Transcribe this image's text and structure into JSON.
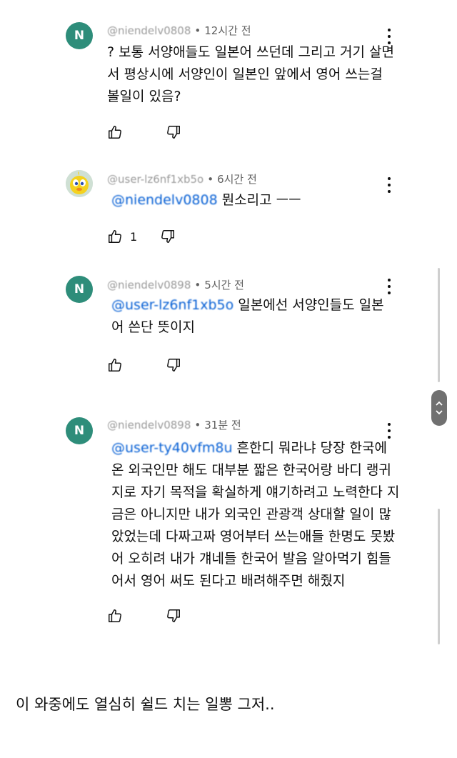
{
  "comments": [
    {
      "avatar_letter": "N",
      "handle": "@niendelv0808",
      "time": "12시간 전",
      "mention": "",
      "text": "? 보통 서양애들도 일본어 쓰던데 그리고 거기 살면\n서 평상시에 서양인이 일본인 앞에서 영어 쓰는걸\n볼일이 있음?",
      "likes": ""
    },
    {
      "avatar_letter": "",
      "handle": "@user-lz6nf1xb5o",
      "time": "6시간 전",
      "mention": "@niendelv0808",
      "text": "뭔소리고 ㅡㅡ",
      "likes": "1"
    },
    {
      "avatar_letter": "N",
      "handle": "@niendelv0898",
      "time": "5시간 전",
      "mention": "@user-lz6nf1xb5o",
      "text": "일본에선 서양인들도 일본\n어 쓴단 뜻이지",
      "likes": ""
    },
    {
      "avatar_letter": "N",
      "handle": "@niendelv0898",
      "time": "31분 전",
      "mention": "@user-ty40vfm8u",
      "text": "흔한디 뭐라냐 당장 한국에\n온 외국인만 해도 대부분 짧은 한국어랑 바디 랭귀\n지로 자기 목적을 확실하게 얘기하려고 노력한다 지\n금은 아니지만 내가 외국인 관광객 상대할 일이 많\n았었는데 다짜고짜 영어부터 쓰는애들 한명도 못봤\n어 오히려 내가 걔네들 한국어 발음 알아먹기 힘들\n어서 영어 써도 된다고 배려해주면 해줬지",
      "likes": ""
    }
  ],
  "meta_separator": "•",
  "caption": "이 와중에도 열심히 쉴드 치는 일뽕 그저..",
  "icons": {
    "like": "thumb-up-icon",
    "dislike": "thumb-down-icon",
    "more": "more-vert-icon"
  },
  "colors": {
    "avatar": "#2e8d7a",
    "mention": "#065fd4",
    "meta": "#606060"
  }
}
